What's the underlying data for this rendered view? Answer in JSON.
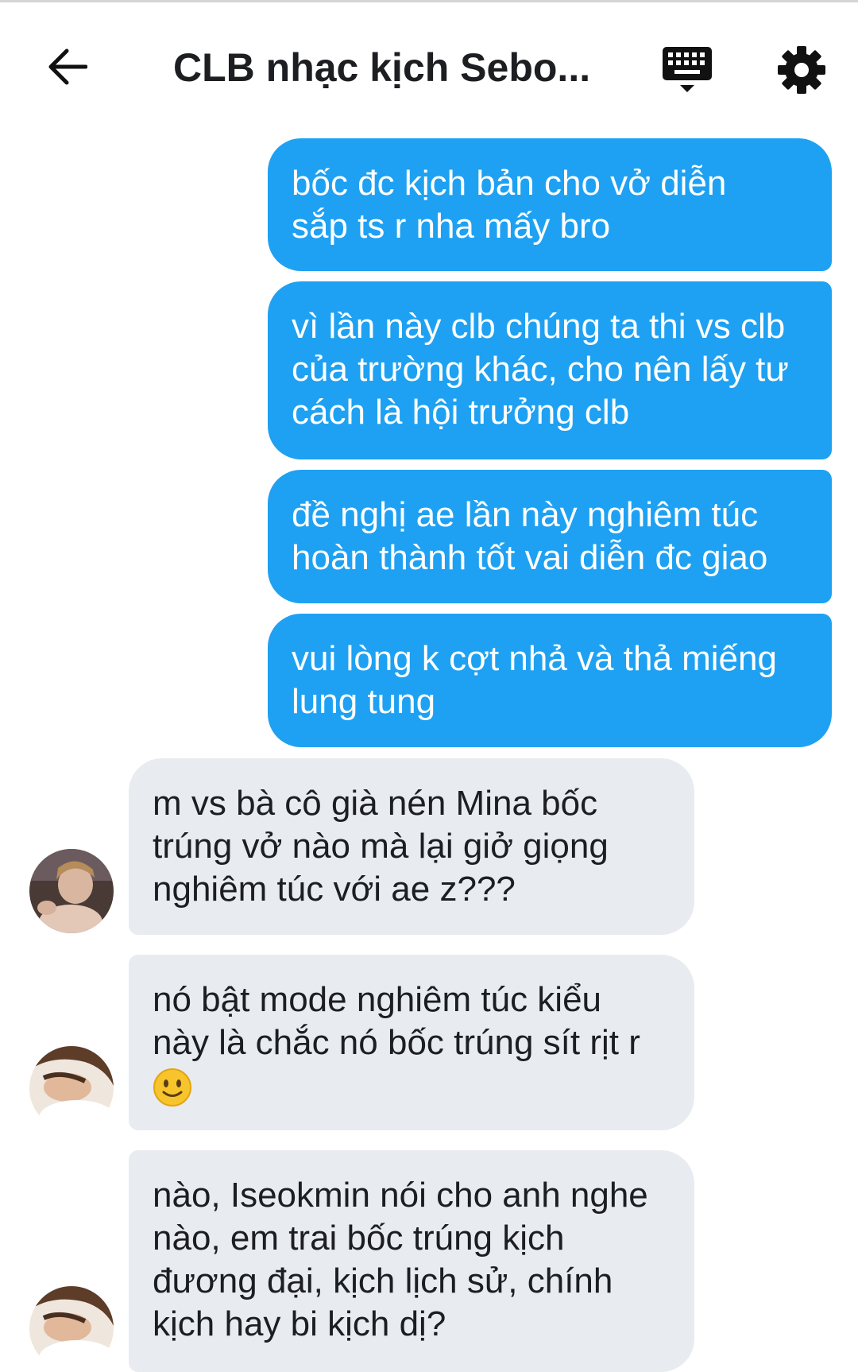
{
  "header": {
    "title": "CLB nhạc kịch Sebo...",
    "back_icon": "arrow-left-icon",
    "keyboard_icon": "keyboard-icon",
    "settings_icon": "gear-icon"
  },
  "colors": {
    "outgoing_bubble": "#1ea1f2",
    "incoming_bubble": "#e8ebef",
    "text_dark": "#1c1e21"
  },
  "messages": [
    {
      "direction": "outgoing",
      "lines": [
        "bốc đc kịch bản cho vở diễn",
        "sắp ts r nha mấy bro"
      ]
    },
    {
      "direction": "outgoing",
      "lines": [
        "vì lần này clb chúng ta thi vs clb",
        "của trường khác, cho nên lấy tư",
        "cách là hội trưởng clb"
      ]
    },
    {
      "direction": "outgoing",
      "lines": [
        "đề nghị ae lần này nghiêm túc",
        "hoàn thành tốt vai diễn đc giao"
      ]
    },
    {
      "direction": "outgoing",
      "lines": [
        "vui lòng k cợt nhả và thả miếng",
        "lung tung"
      ]
    },
    {
      "direction": "incoming",
      "lines": [
        "m vs bà cô già nén Mina bốc",
        "trúng vở nào mà lại giở giọng",
        "nghiêm túc với ae z???"
      ]
    },
    {
      "direction": "incoming",
      "lines": [
        "nó bật mode nghiêm túc kiểu",
        "này là chắc nó bốc trúng sít rịt r"
      ],
      "emoji": "slightly-smiling-face-icon"
    },
    {
      "direction": "incoming",
      "lines": [
        "nào, Iseokmin nói cho anh nghe",
        "nào, em trai bốc trúng kịch",
        "đương đại, kịch lịch sử, chính",
        "kịch hay bi kịch dị?"
      ]
    }
  ]
}
